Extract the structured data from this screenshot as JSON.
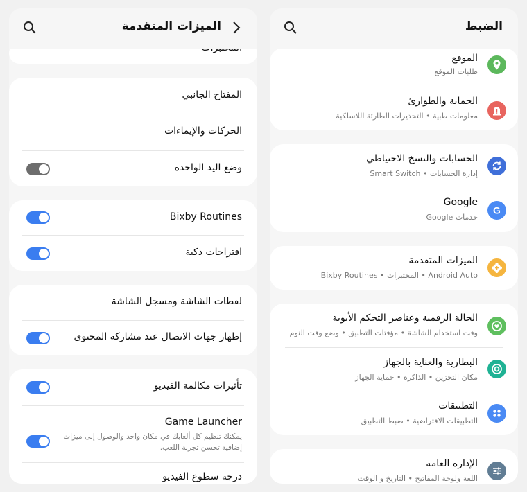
{
  "settings": {
    "title": "الضبط",
    "items": [
      {
        "title": "الموقع",
        "subtitle": "طلبات الموقع",
        "icon": "location-pin-icon",
        "color": "#5cb85c"
      },
      {
        "title": "الحماية والطوارئ",
        "subtitle": "معلومات طبية  •  التحذيرات الطارئة اللاسلكية",
        "icon": "alert-icon",
        "color": "#e8655f"
      },
      {
        "title": "الحسابات والنسخ الاحتياطي",
        "subtitle": "إدارة الحسابات  •  Smart Switch",
        "icon": "sync-icon",
        "color": "#3f6fd9"
      },
      {
        "title": "Google",
        "subtitle": "خدمات Google",
        "icon": "google-icon",
        "color": "#4a8af4"
      },
      {
        "title": "الميزات المتقدمة",
        "subtitle": "Android Auto  •  المختبرات  •  Bixby Routines",
        "icon": "gear-plus-icon",
        "color": "#f5b53f"
      },
      {
        "title": "الحالة الرقمية وعناصر التحكم الأبوية",
        "subtitle": "وقت استخدام الشاشة  •  مؤقتات التطبيق  •  وضع وقت النوم",
        "icon": "heart-circle-icon",
        "color": "#5fbf5f"
      },
      {
        "title": "البطارية والعناية بالجهاز",
        "subtitle": "مكان التخزين  •  الذاكرة  •  حماية الجهاز",
        "icon": "device-care-icon",
        "color": "#1fb294"
      },
      {
        "title": "التطبيقات",
        "subtitle": "التطبيقات الافتراضية  •  ضبط التطبيق",
        "icon": "apps-grid-icon",
        "color": "#4a8af4"
      },
      {
        "title": "الإدارة العامة",
        "subtitle": "اللغة ولوحة المفاتيح  •  التاريخ و الوقت",
        "icon": "sliders-icon",
        "color": "#617d94"
      }
    ]
  },
  "advanced": {
    "title": "الميزات المتقدمة",
    "partial_item": "المختبرات",
    "items": [
      {
        "label": "المفتاح الجانبي"
      },
      {
        "label": "الحركات والإيماءات"
      },
      {
        "label": "وضع اليد الواحدة",
        "toggle": "off"
      },
      {
        "label": "Bixby Routines",
        "toggle": "on"
      },
      {
        "label": "اقتراحات ذكية",
        "toggle": "on"
      },
      {
        "label": "لقطات الشاشة ومسجل الشاشة"
      },
      {
        "label": "إظهار جهات الاتصال عند مشاركة المحتوى",
        "toggle": "on"
      },
      {
        "label": "تأثيرات مكالمة الفيديو",
        "toggle": "on"
      },
      {
        "label": "Game Launcher",
        "subtitle": "يمكنك تنظيم كل ألعابك في مكان واحد والوصول إلى ميزات إضافية تحسن تجربة اللعب.",
        "toggle": "on"
      },
      {
        "label": "درجة سطوع الفيديو"
      }
    ]
  },
  "colors": {
    "accent": "#3a7df0",
    "toggle_off": "#6d6d6d"
  }
}
